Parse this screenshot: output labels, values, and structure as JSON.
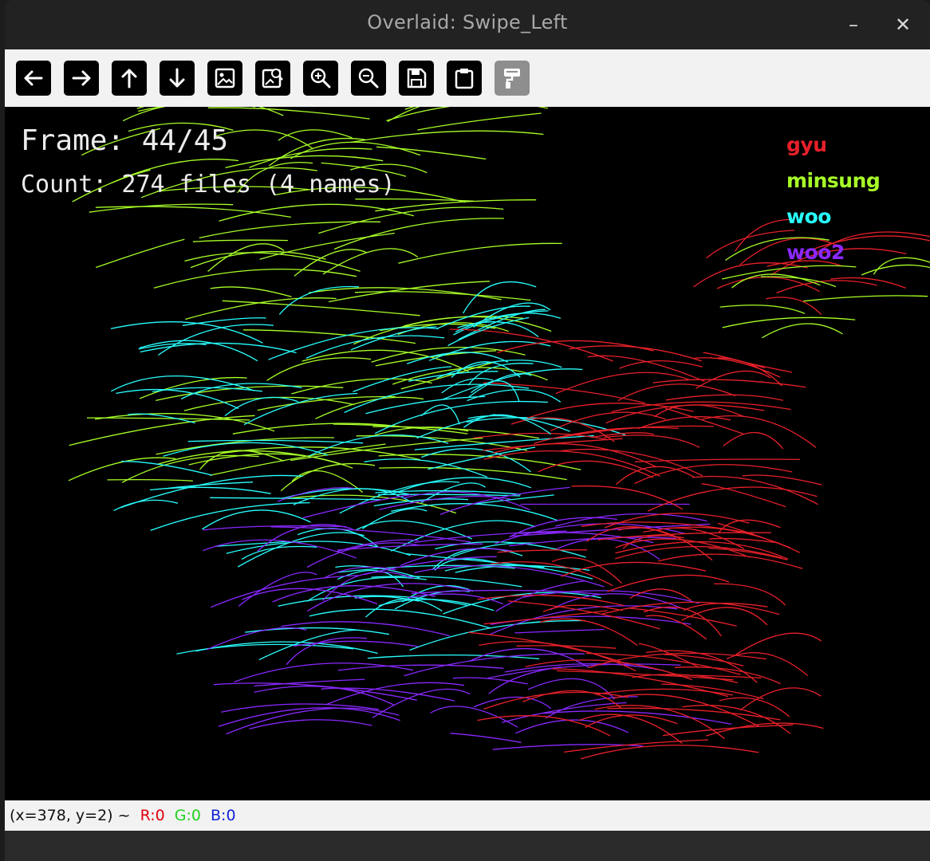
{
  "window": {
    "title": "Overlaid: Swipe_Left",
    "minimize_icon": "minimize-icon",
    "close_icon": "close-icon"
  },
  "toolbar": {
    "tools": [
      {
        "name": "pan-left-button",
        "icon": "arrow-left-icon",
        "enabled": true
      },
      {
        "name": "pan-right-button",
        "icon": "arrow-right-icon",
        "enabled": true
      },
      {
        "name": "pan-up-button",
        "icon": "arrow-up-icon",
        "enabled": true
      },
      {
        "name": "pan-down-button",
        "icon": "arrow-down-icon",
        "enabled": true
      },
      {
        "name": "zoom-fit-button",
        "icon": "image-icon",
        "enabled": true
      },
      {
        "name": "zoom-original-button",
        "icon": "image-zoom-icon",
        "enabled": true
      },
      {
        "name": "zoom-in-button",
        "icon": "zoom-in-icon",
        "enabled": true
      },
      {
        "name": "zoom-out-button",
        "icon": "zoom-out-icon",
        "enabled": true
      },
      {
        "name": "save-button",
        "icon": "save-icon",
        "enabled": true
      },
      {
        "name": "copy-clipboard-button",
        "icon": "clipboard-icon",
        "enabled": true
      },
      {
        "name": "properties-button",
        "icon": "paint-roller-icon",
        "enabled": false
      }
    ]
  },
  "overlay": {
    "frame_text": "Frame: 44/45",
    "count_text": "Count: 274 files (4 names)"
  },
  "legend": [
    {
      "label": "gyu",
      "color": "#e8202a"
    },
    {
      "label": "minsung",
      "color": "#a8ff28"
    },
    {
      "label": "woo",
      "color": "#28ffff"
    },
    {
      "label": "woo2",
      "color": "#8a28ff"
    }
  ],
  "status": {
    "coords": "(x=378, y=2) ~",
    "r": "R:0",
    "g": "G:0",
    "b": "B:0",
    "r_color": "#e0000d",
    "g_color": "#1fd11f",
    "b_color": "#1022d8"
  }
}
